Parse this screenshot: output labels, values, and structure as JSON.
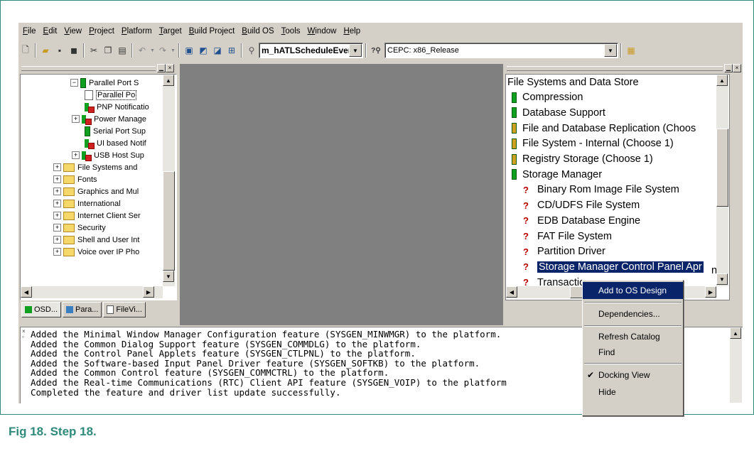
{
  "menu": [
    "File",
    "Edit",
    "View",
    "Project",
    "Platform",
    "Target",
    "Build Project",
    "Build OS",
    "Tools",
    "Window",
    "Help"
  ],
  "toolbar": {
    "symbol_combo": "m_hATLScheduleEvent",
    "config_combo": "CEPC: x86_Release"
  },
  "left_tree": [
    {
      "label": "Parallel Port S",
      "type": "green",
      "expander": "-"
    },
    {
      "label": "Parallel Po",
      "type": "doc",
      "expander": ""
    },
    {
      "label": "PNP Notificatio",
      "type": "pkg",
      "expander": ""
    },
    {
      "label": "Power Manage",
      "type": "pkg",
      "expander": "+"
    },
    {
      "label": "Serial Port Sup",
      "type": "green",
      "expander": ""
    },
    {
      "label": "UI based Notif",
      "type": "pkg",
      "expander": ""
    },
    {
      "label": "USB Host Sup",
      "type": "pkg",
      "expander": "+"
    },
    {
      "label": "File Systems and",
      "type": "folder",
      "expander": "+"
    },
    {
      "label": "Fonts",
      "type": "folder",
      "expander": "+"
    },
    {
      "label": "Graphics and Mul",
      "type": "folder",
      "expander": "+"
    },
    {
      "label": "International",
      "type": "folder",
      "expander": "+"
    },
    {
      "label": "Internet Client Ser",
      "type": "folder",
      "expander": "+"
    },
    {
      "label": "Security",
      "type": "folder",
      "expander": "+"
    },
    {
      "label": "Shell and User Int",
      "type": "folder",
      "expander": "+"
    },
    {
      "label": "Voice over IP Pho",
      "type": "folder",
      "expander": "+"
    }
  ],
  "left_tabs": [
    "OSD...",
    "Para...",
    "FileVi..."
  ],
  "catalog": [
    {
      "label": "File Systems and Data Store",
      "type": "none"
    },
    {
      "label": "Compression",
      "type": "green"
    },
    {
      "label": "Database Support",
      "type": "green"
    },
    {
      "label": "File and Database Replication (Choos",
      "type": "green2"
    },
    {
      "label": "File System - Internal (Choose 1)",
      "type": "green2"
    },
    {
      "label": "Registry Storage (Choose 1)",
      "type": "green2"
    },
    {
      "label": "Storage Manager",
      "type": "green"
    },
    {
      "label": "Binary Rom Image File System",
      "type": "q"
    },
    {
      "label": "CD/UDFS File System",
      "type": "q"
    },
    {
      "label": "EDB Database Engine",
      "type": "q"
    },
    {
      "label": "FAT File System",
      "type": "q"
    },
    {
      "label": "Partition Driver",
      "type": "q"
    },
    {
      "label": "Storage Manager Control Panel Apr",
      "type": "q",
      "selected": true
    },
    {
      "label": "Transactio",
      "type": "q"
    }
  ],
  "catalog_tail": "n",
  "output": [
    "Added the Minimal Window Manager Configuration feature (SYSGEN_MINWMGR) to the platform.",
    "Added the Common Dialog Support feature (SYSGEN_COMMDLG) to the platform.",
    "Added the Control Panel Applets feature (SYSGEN_CTLPNL) to the platform.",
    "Added the Software-based Input Panel Driver feature (SYSGEN_SOFTKB) to the platform.",
    "Added the Common Control feature (SYSGEN_COMMCTRL) to the platform.",
    "Added the Real-time Communications (RTC) Client API feature (SYSGEN_VOIP) to the platform",
    "Completed the feature and driver list update successfully."
  ],
  "context_menu": {
    "add": "Add to OS Design",
    "dependencies": "Dependencies...",
    "refresh": "Refresh Catalog",
    "find": "Find",
    "docking": "Docking View",
    "hide": "Hide"
  },
  "caption": "Fig 18.  Step 18.",
  "colors": {
    "accent": "#2f8a7a",
    "selection": "#0a246a",
    "chrome": "#d4d0c8"
  }
}
